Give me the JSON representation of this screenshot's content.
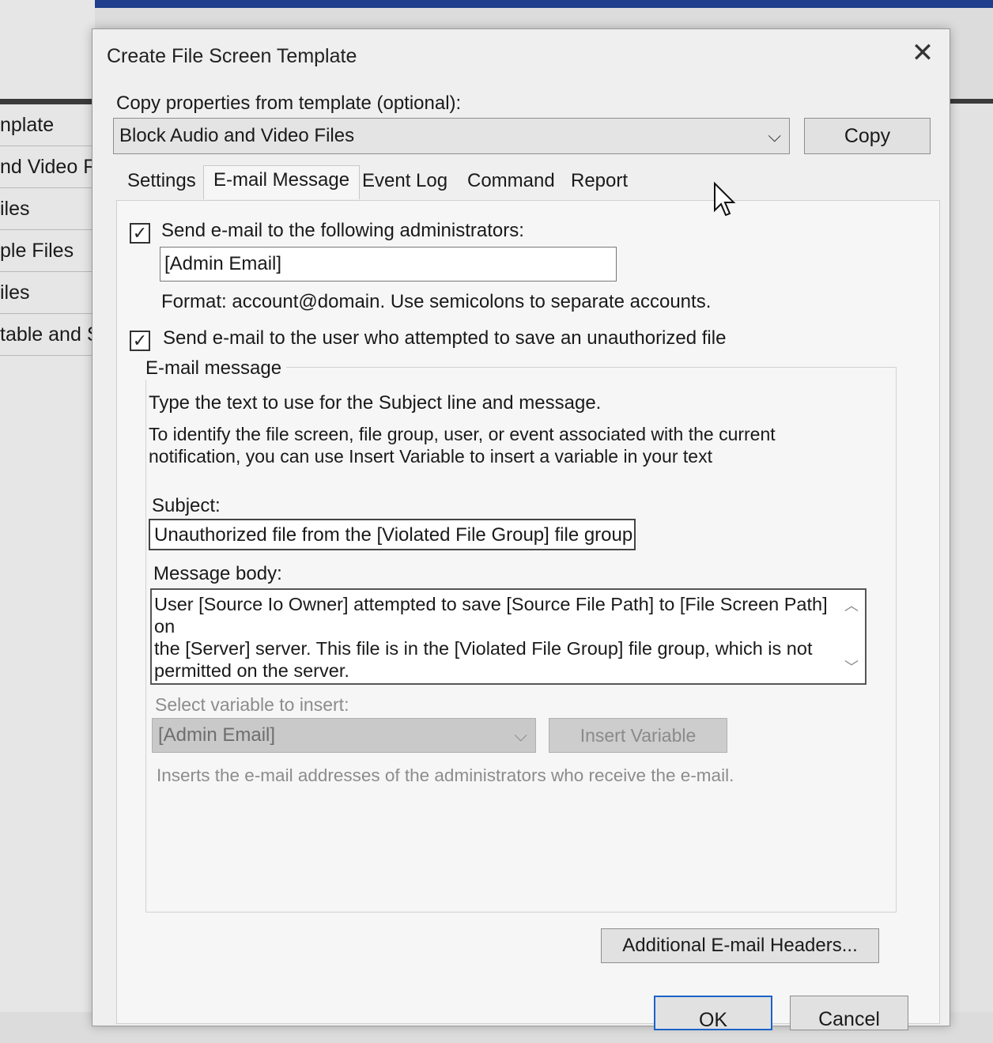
{
  "background": {
    "list_items": [
      "nplate",
      "nd Video Fi",
      "iles",
      "ple Files",
      "iles",
      "table and S"
    ]
  },
  "dialog": {
    "title": "Create File Screen Template",
    "copy_from_label": "Copy properties from template (optional):",
    "template_selected": "Block Audio and Video Files",
    "copy_button": "Copy",
    "tabs": [
      {
        "label": "Settings",
        "active": false
      },
      {
        "label": "E-mail Message",
        "active": true
      },
      {
        "label": "Event Log",
        "active": false
      },
      {
        "label": "Command",
        "active": false
      },
      {
        "label": "Report",
        "active": false
      }
    ],
    "email": {
      "send_admin_label": "Send e-mail to the following administrators:",
      "send_admin_checked": true,
      "admin_field_value": "[Admin Email]",
      "format_hint": "Format: account@domain. Use semicolons to separate accounts.",
      "send_user_label": "Send e-mail to the user who attempted to save an unauthorized file",
      "send_user_checked": true,
      "group_title": "E-mail message",
      "instruction_1": "Type the text to use for the Subject line and message.",
      "instruction_2a": "To identify the file screen, file group, user, or event associated with the current",
      "instruction_2b": "notification, you can use Insert Variable to insert a variable in your text",
      "subject_label": "Subject:",
      "subject_value": "Unauthorized file from the [Violated File Group] file group det",
      "body_label": "Message body:",
      "body_line_1": "User [Source Io Owner] attempted to save [Source File Path] to [File Screen Path] on",
      "body_line_2": "the [Server] server. This file is in the [Violated File Group] file group, which is not",
      "body_line_3": "permitted on the server.",
      "variable_label": "Select variable to insert:",
      "variable_selected": "[Admin Email]",
      "insert_button": "Insert Variable",
      "variable_description": "Inserts the e-mail addresses of the administrators who receive the e-mail.",
      "headers_button": "Additional E-mail Headers..."
    },
    "ok_button": "OK",
    "cancel_button": "Cancel"
  }
}
